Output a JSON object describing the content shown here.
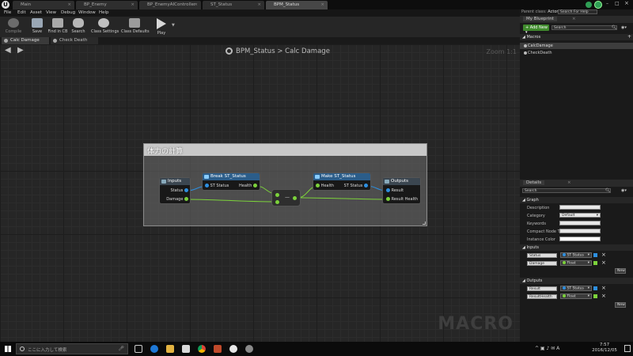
{
  "window": {
    "app_icon": "unreal-logo-icon",
    "doc_tabs": [
      {
        "label": "Main",
        "active": false
      },
      {
        "label": "BP_Enemy",
        "active": false
      },
      {
        "label": "BP_EnemyAIController",
        "active": false
      },
      {
        "label": "ST_Status",
        "active": false
      },
      {
        "label": "BPM_Status",
        "active": true
      }
    ],
    "parent_class_label": "Parent class:",
    "parent_class_value": "Actor",
    "search_help_placeholder": "Search For Help"
  },
  "menu": [
    "File",
    "Edit",
    "Asset",
    "View",
    "Debug",
    "Window",
    "Help"
  ],
  "toolbar": {
    "buttons": [
      {
        "label": "Compile",
        "icon": "compile-gear-icon"
      },
      {
        "label": "Save",
        "icon": "save-disk-icon"
      },
      {
        "label": "Find in CB",
        "icon": "find-in-content-browser-icon"
      },
      {
        "label": "Search",
        "icon": "binoculars-icon"
      },
      {
        "label": "Class Settings",
        "icon": "gears-icon"
      },
      {
        "label": "Class Defaults",
        "icon": "checklist-icon"
      },
      {
        "label": "Play",
        "icon": "play-icon"
      }
    ]
  },
  "graph_tabs": [
    {
      "label": "Calc Damage",
      "active": true
    },
    {
      "label": "Check Death",
      "active": false
    }
  ],
  "graph": {
    "breadcrumb_root": "BPM_Status",
    "breadcrumb_sep": ">",
    "breadcrumb_leaf": "Calc Damage",
    "zoom": "Zoom 1:1",
    "watermark": "MACRO",
    "comment_title": "体力の計算",
    "nodes": {
      "inputs": {
        "title": "Inputs",
        "pins": [
          "Status",
          "Damage"
        ]
      },
      "break": {
        "title": "Break ST_Status",
        "in_pin": "ST Status",
        "out_pin": "Health"
      },
      "subtract": {
        "title": ""
      },
      "make": {
        "title": "Make ST_Status",
        "in_pin": "Health",
        "out_pin": "ST Status"
      },
      "outputs": {
        "title": "Outputs",
        "pins": [
          "Result",
          "Result Health"
        ]
      }
    }
  },
  "my_blueprint": {
    "tab_label": "My Blueprint",
    "add_new": "Add New",
    "search_placeholder": "Search",
    "section_macros": "Macros",
    "macros": [
      "CalcDamage",
      "CheckDeath"
    ]
  },
  "details": {
    "tab_label": "Details",
    "search_placeholder": "Search",
    "section_graph": "Graph",
    "graph_fields": [
      {
        "label": "Description",
        "value": ""
      },
      {
        "label": "Category",
        "value": "Default"
      },
      {
        "label": "Keywords",
        "value": ""
      },
      {
        "label": "Compact Node Title",
        "value": ""
      },
      {
        "label": "Instance Color",
        "value": ""
      }
    ],
    "section_inputs": "Inputs",
    "inputs": [
      {
        "name": "Status",
        "type": "ST Status"
      },
      {
        "name": "Damage",
        "type": "Float"
      }
    ],
    "section_outputs": "Outputs",
    "outputs": [
      {
        "name": "Result",
        "type": "ST Status"
      },
      {
        "name": "ResultHealth",
        "type": "Float"
      }
    ],
    "new_button": "New"
  },
  "taskbar": {
    "search_placeholder": "ここに入力して検索",
    "time": "7:57",
    "date": "2016/12/05"
  },
  "colors": {
    "struct_pin": "#2d8fe0",
    "float_pin": "#7cd23b",
    "exec_wire": "#ffffff",
    "add_new_button": "#3f8a2c"
  }
}
